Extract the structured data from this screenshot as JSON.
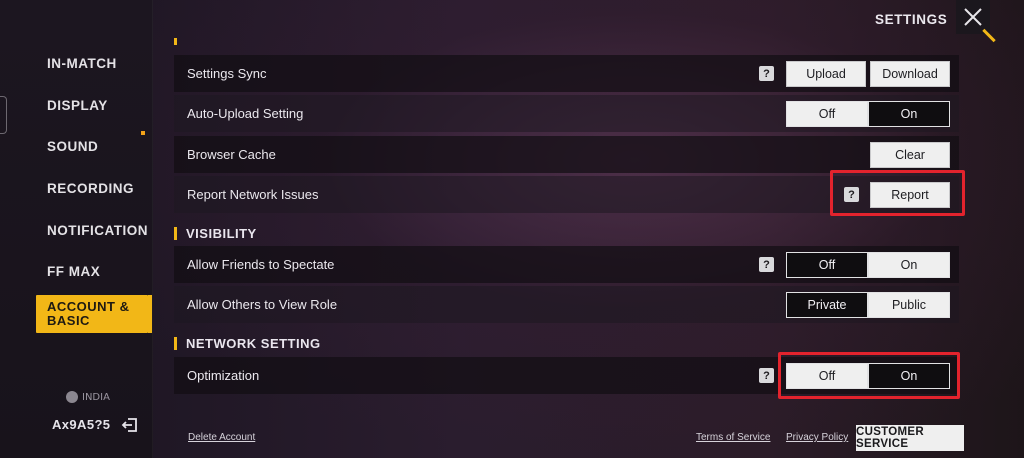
{
  "header": {
    "title": "SETTINGS"
  },
  "sidebar": {
    "items": [
      {
        "label": "IN-MATCH"
      },
      {
        "label": "DISPLAY"
      },
      {
        "label": "SOUND"
      },
      {
        "label": "RECORDING"
      },
      {
        "label": "NOTIFICATION"
      },
      {
        "label": "FF MAX"
      },
      {
        "label": "ACCOUNT & BASIC",
        "active": true
      }
    ],
    "region": "INDIA",
    "user_id": "Ax9A5?5"
  },
  "sections": {
    "tools": {
      "rows": [
        {
          "label": "Settings Sync",
          "help": "?",
          "buttons": [
            "Upload",
            "Download"
          ]
        },
        {
          "label": "Auto-Upload Setting",
          "options": [
            "Off",
            "On"
          ],
          "selected": "On"
        },
        {
          "label": "Browser Cache",
          "buttons": [
            "Clear"
          ]
        },
        {
          "label": "Report Network Issues",
          "help": "?",
          "buttons": [
            "Report"
          ]
        }
      ]
    },
    "visibility": {
      "title": "VISIBILITY",
      "rows": [
        {
          "label": "Allow Friends to Spectate",
          "help": "?",
          "options": [
            "Off",
            "On"
          ],
          "selected": "Off"
        },
        {
          "label": "Allow Others to View Role",
          "options": [
            "Private",
            "Public"
          ],
          "selected": "Private"
        }
      ]
    },
    "network": {
      "title": "NETWORK SETTING",
      "rows": [
        {
          "label": "Optimization",
          "help": "?",
          "options": [
            "Off",
            "On"
          ],
          "selected": "On"
        }
      ]
    }
  },
  "footer": {
    "delete_account": "Delete Account",
    "terms": "Terms of Service",
    "privacy": "Privacy Policy",
    "customer_service": "CUSTOMER SERVICE"
  },
  "colors": {
    "accent": "#f2b717",
    "highlight": "#e3232d"
  }
}
